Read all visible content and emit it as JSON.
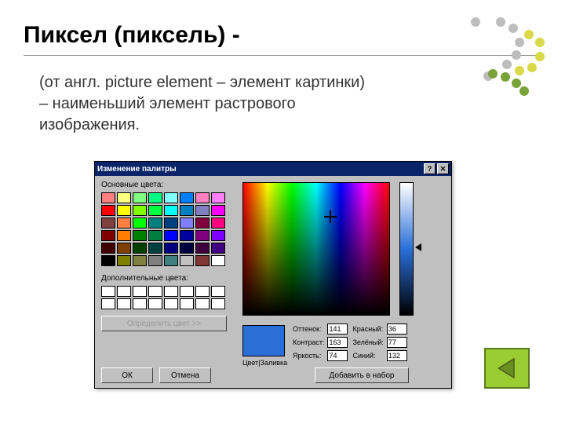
{
  "title": "Пиксел (пиксель) -",
  "description": "(от англ. picture element – элемент картинки) – наименьший элемент растрового изображения.",
  "decor_colors": [
    "#bdbdbd",
    "#bdbdbd",
    "#bdbdbd",
    "#bdbdbd",
    "#bdbdbd",
    "#bdbdbd",
    "#bdbdbd",
    "#d9d94a",
    "#d9d94a",
    "#d9d94a",
    "#d9d94a",
    "#d9d94a",
    "#7aa23a",
    "#7aa23a",
    "#7aa23a",
    "#7aa23a"
  ],
  "dialog": {
    "title": "Изменение палитры",
    "help_glyph": "?",
    "close_glyph": "✕",
    "basic_label": "Основные цвета:",
    "custom_label": "Дополнительные цвета:",
    "define_label": "Определить цвет >>",
    "ok_label": "ОК",
    "cancel_label": "Отмена",
    "add_label": "Добавить в набор",
    "preview_label": "Цвет|Заливка",
    "basic_swatches": [
      "#ff8080",
      "#ffff80",
      "#80ff80",
      "#00ff80",
      "#80ffff",
      "#0080ff",
      "#ff80c0",
      "#ff80ff",
      "#ff0000",
      "#ffff00",
      "#80ff00",
      "#00ff40",
      "#00ffff",
      "#0080c0",
      "#8080c0",
      "#ff00ff",
      "#804040",
      "#ff8040",
      "#00ff00",
      "#008080",
      "#004080",
      "#8080ff",
      "#800040",
      "#ff0080",
      "#800000",
      "#ff8000",
      "#008000",
      "#008040",
      "#0000ff",
      "#0000a0",
      "#800080",
      "#8000ff",
      "#400000",
      "#804000",
      "#004000",
      "#004040",
      "#000080",
      "#000040",
      "#400040",
      "#400080",
      "#000000",
      "#808000",
      "#808040",
      "#808080",
      "#408080",
      "#c0c0c0",
      "#823636",
      "#ffffff"
    ],
    "fields": {
      "hue": {
        "label": "Оттенок:",
        "value": "141"
      },
      "sat": {
        "label": "Контраст:",
        "value": "163"
      },
      "lum": {
        "label": "Яркость:",
        "value": "74"
      },
      "red": {
        "label": "Красный:",
        "value": "36"
      },
      "green": {
        "label": "Зелёный:",
        "value": "77"
      },
      "blue": {
        "label": "Синий:",
        "value": "132"
      }
    }
  }
}
